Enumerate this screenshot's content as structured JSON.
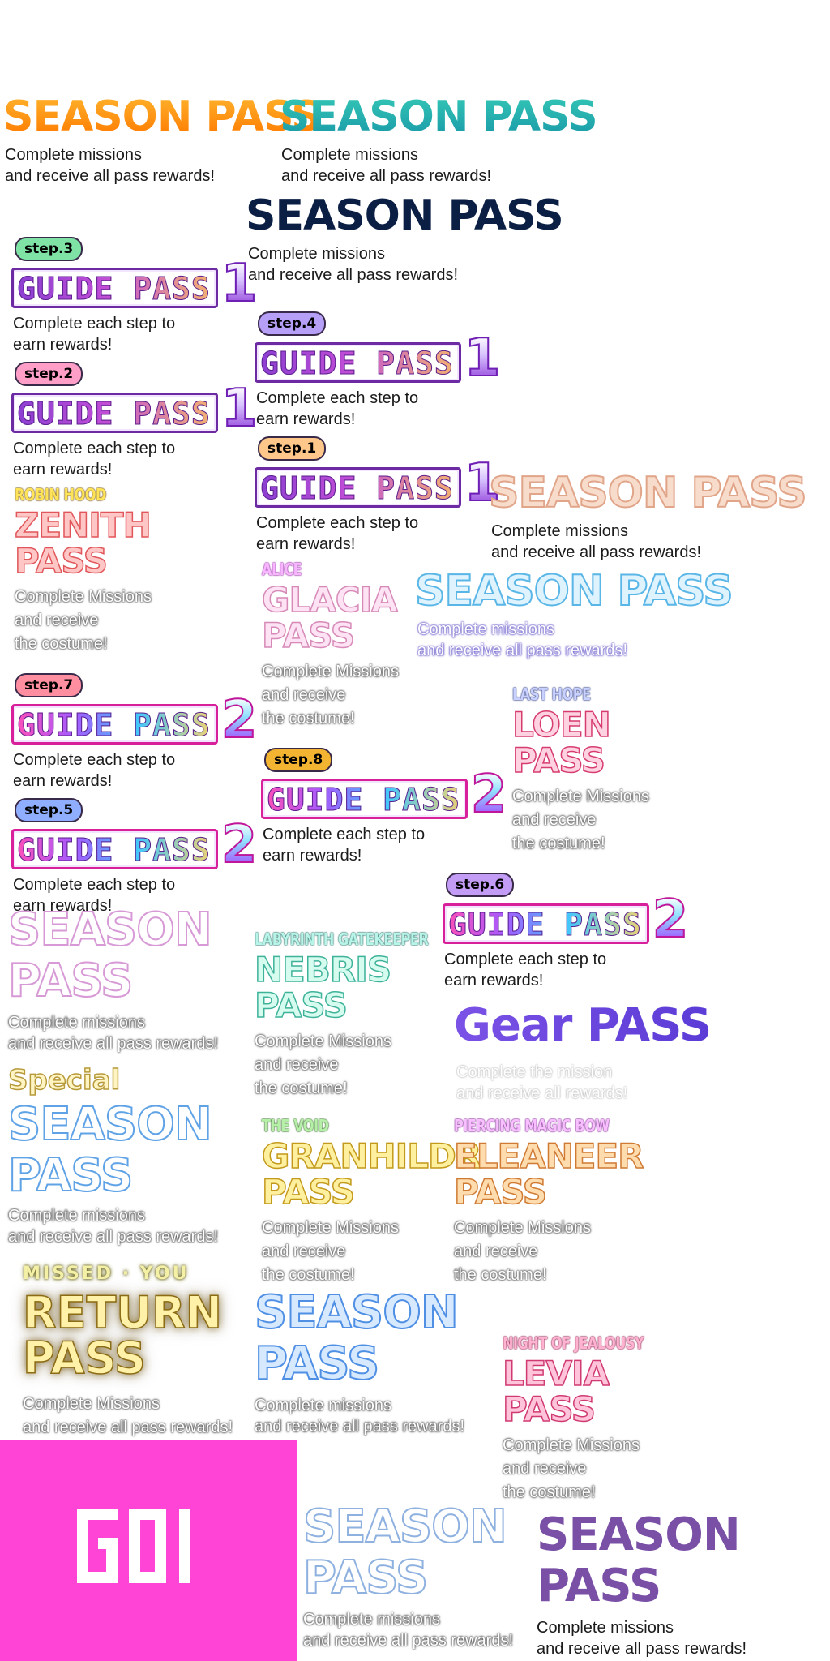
{
  "season_pass_title": "SEASON PASS",
  "season_desc_line1": "Complete missions",
  "season_desc_line2": "and receive all pass rewards!",
  "special_label": "Special",
  "season_word": "SEASON",
  "pass_word": "PASS",
  "guide_word": "GUIDE PASS",
  "guide_desc_line1": "Complete each step to",
  "guide_desc_line2": "earn rewards!",
  "steps": {
    "s1": "step.1",
    "s2": "step.2",
    "s3": "step.3",
    "s4": "step.4",
    "s5": "step.5",
    "s6": "step.6",
    "s7": "step.7",
    "s8": "step.8"
  },
  "guide_numbers": {
    "one": "1",
    "two": "2"
  },
  "costume_desc_line1": "Complete Missions",
  "costume_desc_line2": "and receive",
  "costume_desc_line3": "the costume!",
  "costume_passes": {
    "zenith": {
      "tag": "ROBIN HOOD",
      "name": "ZENITH"
    },
    "glacia": {
      "tag": "ALICE",
      "name": "GLACIA"
    },
    "loen": {
      "tag": "LAST HOPE",
      "name": "LOEN"
    },
    "nebris": {
      "tag": "LABYRINTH GATEKEEPER",
      "name": "NEBRIS"
    },
    "granhildr": {
      "tag": "THE VOID",
      "name": "GRANHILDR"
    },
    "eleaneer": {
      "tag": "PIERCING MAGIC BOW",
      "name": "ELEANEER"
    },
    "levia": {
      "tag": "NIGHT OF JEALOUSY",
      "name": "LEVIA"
    }
  },
  "gear_pass": {
    "title": "Gear PASS",
    "line1": "Complete the mission",
    "line2": "and receive all rewards!"
  },
  "return_pass": {
    "missed": "MISSED · YOU",
    "title_line1": "RETURN",
    "title_line2": "PASS",
    "line1": "Complete Missions",
    "line2": "and receive all pass rewards!"
  },
  "colors": {
    "magenta_logo_bg": "#ff44d6",
    "guide_purple": "#6c2aa3",
    "season_orange": "#ff9a1a",
    "season_teal": "#1a9aa8",
    "season_navy": "#0b1f44",
    "gear_purple": "#5b3cd6"
  },
  "icons": {
    "logo": "pixel-logo-icon"
  }
}
